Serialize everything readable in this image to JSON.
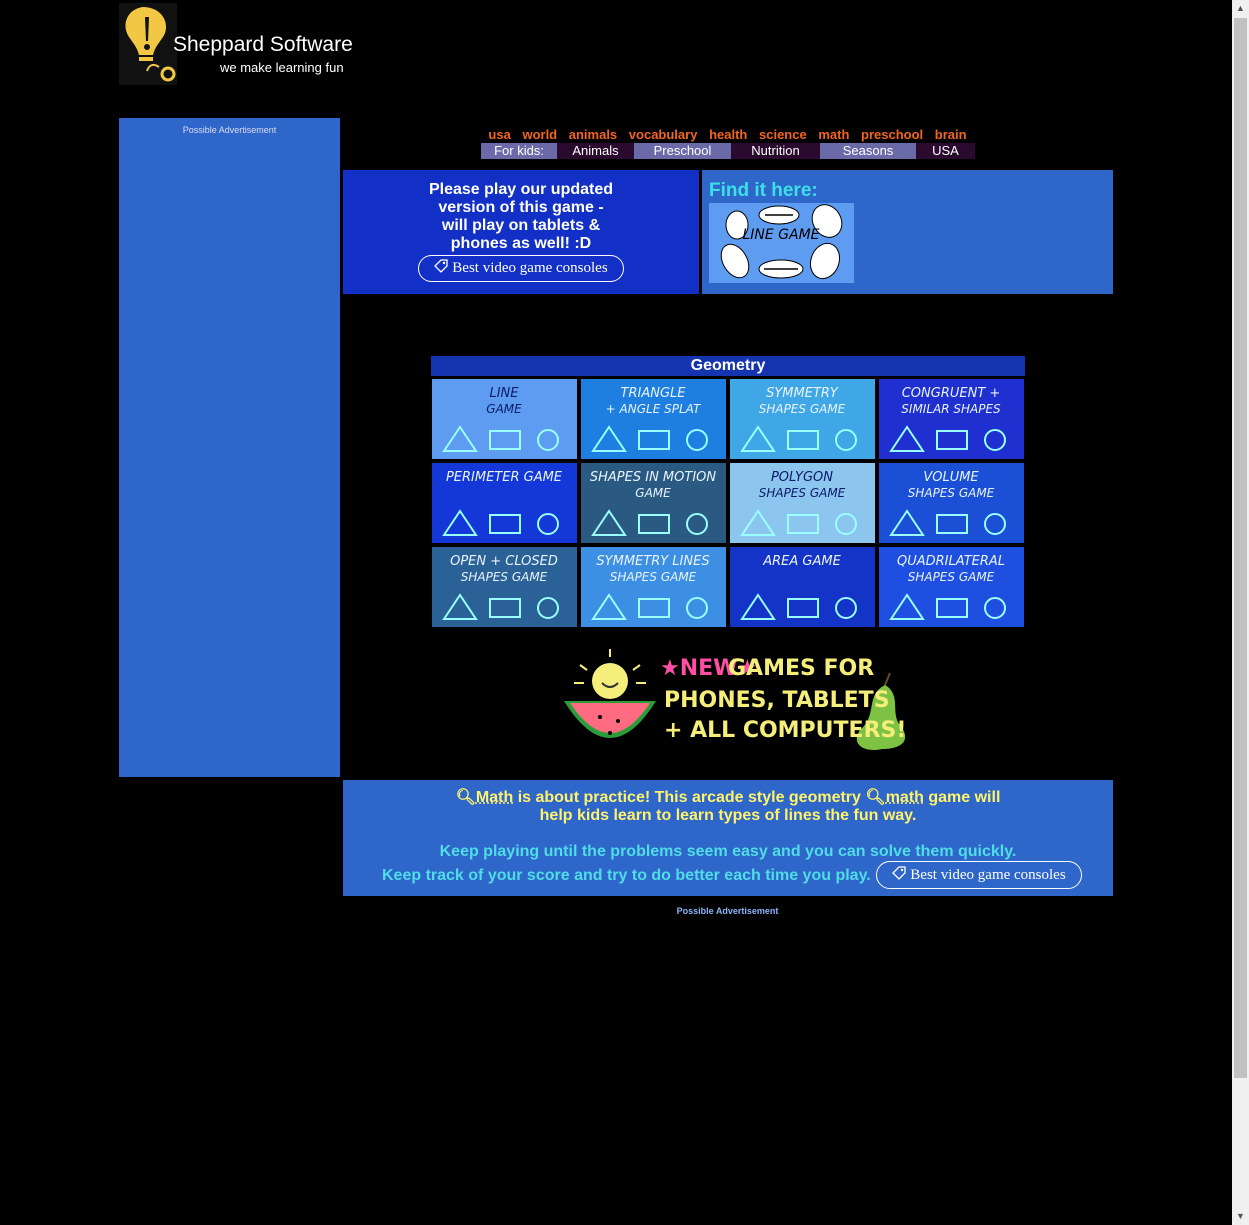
{
  "logo": {
    "brand": "Sheppard Software",
    "tagline": "we make learning fun"
  },
  "ads": {
    "left_label": "Possible Advertisement",
    "bottom_label": "Possible Advertisement"
  },
  "topnav": [
    "usa",
    "world",
    "animals",
    "vocabulary",
    "health",
    "science",
    "math",
    "preschool",
    "brain"
  ],
  "kidsnav": {
    "label": "For kids:",
    "items": [
      "Animals",
      "Preschool",
      "Nutrition",
      "Seasons",
      "USA"
    ]
  },
  "update_box": {
    "line1": "Please play our updated",
    "line2": "version of this game -",
    "line3": "will play on tablets &",
    "line4": "phones as well! :D",
    "button": "Best video game consoles"
  },
  "find_box": {
    "label": "Find it here:",
    "thumb_title": "LINE GAME"
  },
  "geometry": {
    "header": "Geometry",
    "tiles": [
      {
        "title1": "LINE",
        "title2": "GAME",
        "color": "#5d9cf0"
      },
      {
        "title1": "TRIANGLE",
        "title2": "+ ANGLE SPLAT",
        "color": "#1e7fe0"
      },
      {
        "title1": "SYMMETRY",
        "title2": "SHAPES GAME",
        "color": "#3fa7e6"
      },
      {
        "title1": "CONGRUENT +",
        "title2": "SIMILAR SHAPES",
        "color": "#1f2fd0"
      },
      {
        "title1": "PERIMETER GAME",
        "title2": "",
        "color": "#1437d8"
      },
      {
        "title1": "SHAPES IN MOTION",
        "title2": "GAME",
        "color": "#2a5a82"
      },
      {
        "title1": "POLYGON",
        "title2": "SHAPES GAME",
        "color": "#8cc6ef"
      },
      {
        "title1": "VOLUME",
        "title2": "SHAPES GAME",
        "color": "#1a4fd6"
      },
      {
        "title1": "OPEN + CLOSED",
        "title2": "SHAPES GAME",
        "color": "#2a6196"
      },
      {
        "title1": "SYMMETRY LINES",
        "title2": "SHAPES GAME",
        "color": "#3d8fe3"
      },
      {
        "title1": "AREA GAME",
        "title2": "",
        "color": "#1434c8"
      },
      {
        "title1": "QUADRILATERAL",
        "title2": "SHAPES GAME",
        "color": "#1f4fe0"
      }
    ]
  },
  "newgames": {
    "new": "NEW",
    "line1": "GAMES FOR",
    "line2": "PHONES, TABLETS",
    "line3": "+ ALL COMPUTERS!"
  },
  "info": {
    "kw1": "Math",
    "text1a": " is about practice! This arcade style geometry ",
    "kw2": "math",
    "text1b": " game will",
    "text1c": "help kids learn to learn types of lines the fun way.",
    "text2": "Keep playing until the problems seem easy and you can solve them quickly.",
    "text3": "Keep track of your score and try to do better each time you play.",
    "button": "Best video game consoles"
  },
  "colors": {
    "page_bg": "#000000",
    "panel_blue": "#2e66c9",
    "nav_orange": "#f26522"
  }
}
